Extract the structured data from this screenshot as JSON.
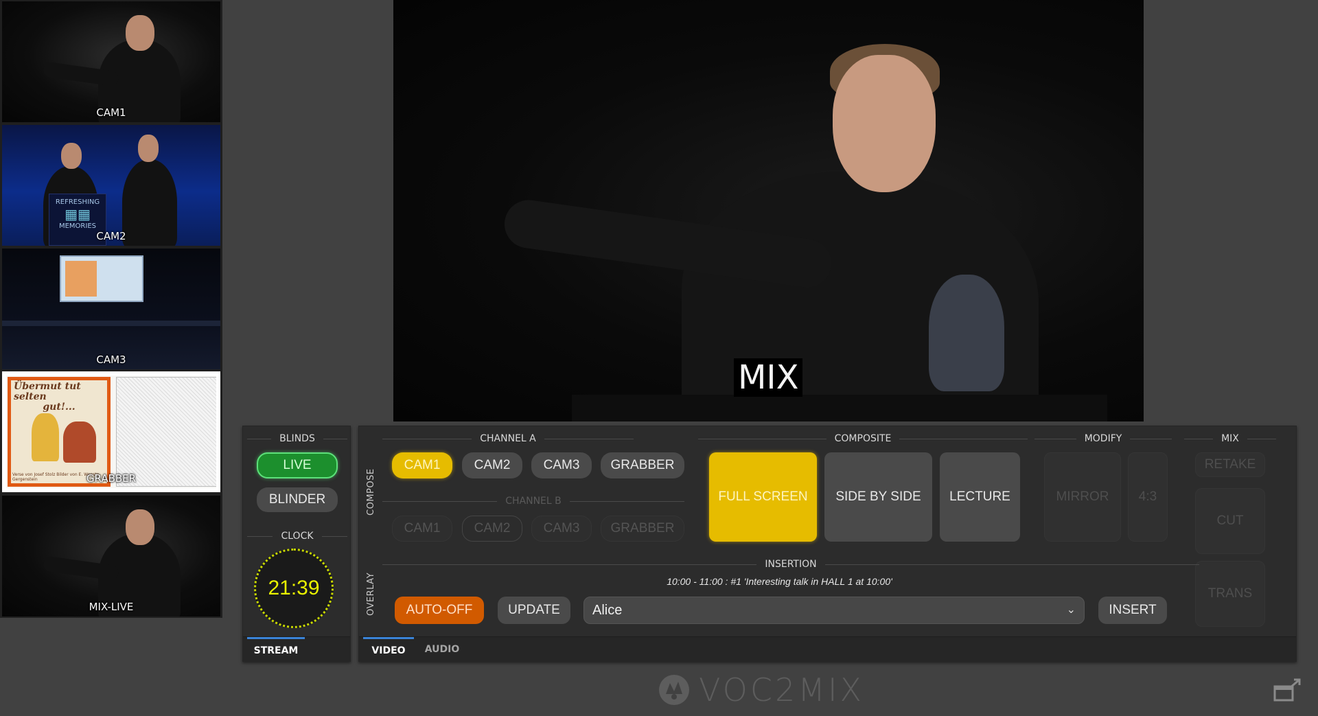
{
  "previews": [
    {
      "label": "CAM1"
    },
    {
      "label": "CAM2"
    },
    {
      "label": "CAM3"
    },
    {
      "label": "GRABBER"
    },
    {
      "label": "MIX-LIVE"
    }
  ],
  "grabber_slide": {
    "title_line1": "Übermut tut selten",
    "title_line2": "gut!...",
    "footer": "Verse von Josef Stolz  Bilder von E. Weeste-Gergenstein"
  },
  "cam2_banner": {
    "line1": "REFRESHING",
    "line2": "MEMORIES"
  },
  "program": {
    "label": "MIX"
  },
  "blinds": {
    "title": "BLINDS",
    "live_label": "LIVE",
    "blinder_label": "BLINDER"
  },
  "clock": {
    "title": "CLOCK",
    "time": "21:39"
  },
  "left_tabs": {
    "stream": "STREAM"
  },
  "compose": {
    "vertical_label": "COMPOSE",
    "channel_a_title": "CHANNEL A",
    "channel_b_title": "CHANNEL B",
    "channel_a": [
      "CAM1",
      "CAM2",
      "CAM3",
      "GRABBER"
    ],
    "channel_b": [
      "CAM1",
      "CAM2",
      "CAM3",
      "GRABBER"
    ],
    "channel_a_selected": "CAM1"
  },
  "composite": {
    "title": "COMPOSITE",
    "buttons": [
      "FULL SCREEN",
      "SIDE BY SIDE",
      "LECTURE"
    ],
    "selected": "FULL SCREEN"
  },
  "modify": {
    "title": "MODIFY",
    "buttons": [
      "MIRROR",
      "4:3"
    ]
  },
  "mix": {
    "title": "MIX",
    "buttons": [
      "RETAKE",
      "CUT",
      "TRANS"
    ]
  },
  "overlay": {
    "vertical_label": "OVERLAY",
    "insertion_title": "INSERTION",
    "insertion_text": "10:00 - 11:00 : #1  'Interesting talk in HALL 1 at 10:00'",
    "auto_off_label": "AUTO-OFF",
    "update_label": "UPDATE",
    "selected_name": "Alice",
    "insert_label": "INSERT"
  },
  "main_tabs": {
    "video": "VIDEO",
    "audio": "AUDIO"
  },
  "footer": {
    "logo_text": "VOC2MIX"
  },
  "colors": {
    "accent_yellow": "#e6bc00",
    "live_green": "#1c8f2d",
    "orange": "#d15a00",
    "tab_active": "#3a84d8",
    "clock": "#e9f200"
  }
}
